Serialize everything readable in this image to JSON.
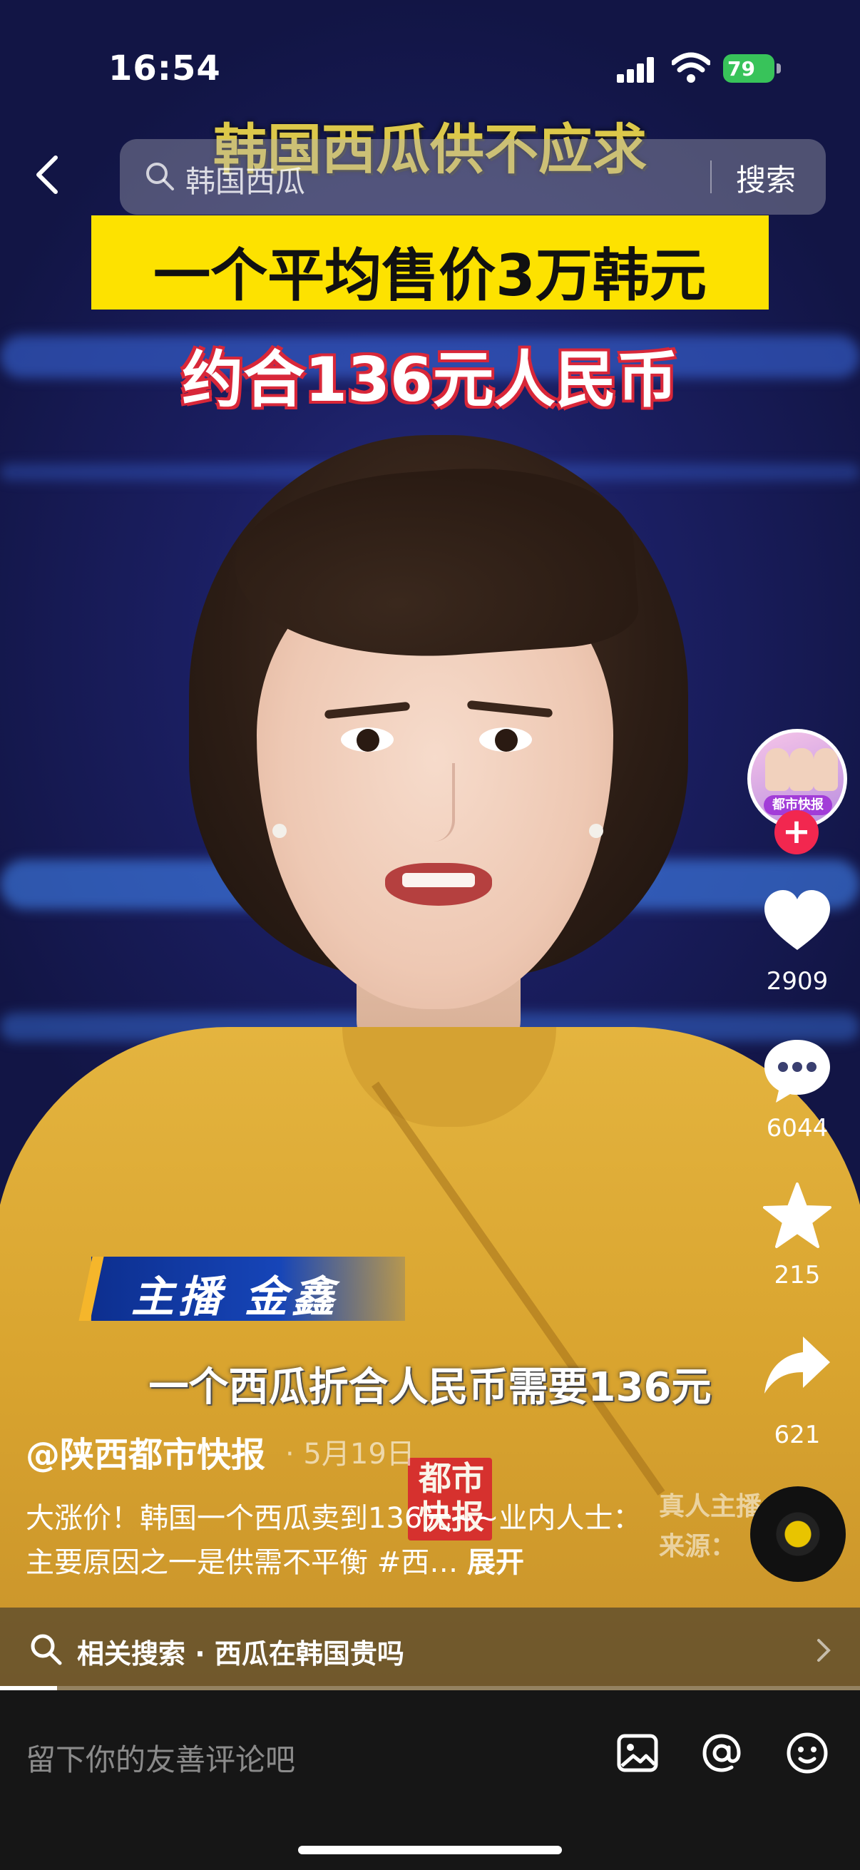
{
  "status_bar": {
    "time": "16:54",
    "battery": "79"
  },
  "search": {
    "query": "韩国西瓜",
    "button_label": "搜索"
  },
  "video": {
    "headline_1": "韩国西瓜供不应求",
    "headline_2": "一个平均售价3万韩元",
    "headline_3": "约合136元人民币",
    "anchor_label": "主播  金鑫",
    "subtitle": "一个西瓜折合人民币需要136元",
    "logo_text": "都市快报",
    "watermark_line1": "真人主播",
    "watermark_line2": "来源："
  },
  "actions": {
    "avatar_label": "都市快报",
    "follow_symbol": "+",
    "likes": "2909",
    "comments": "6044",
    "favorites": "215",
    "shares": "621"
  },
  "post": {
    "author": "@陕西都市快报",
    "date": "· 5月19日",
    "description": "大涨价！韩国一个西瓜卖到136元~~业内人士：主要原因之一是供需不平衡 #西…",
    "expand_label": "展开"
  },
  "related": {
    "text": "相关搜索 · 西瓜在韩国贵吗"
  },
  "comment_bar": {
    "placeholder": "留下你的友善评论吧"
  },
  "colors": {
    "accent_red": "#f2274f",
    "caption_yellow": "#fde200",
    "battery_green": "#38c35a"
  },
  "icons": [
    "back-icon",
    "search-icon",
    "heart-icon",
    "comment-icon",
    "star-icon",
    "share-icon",
    "image-icon",
    "at-icon",
    "emoji-icon",
    "chevron-right-icon"
  ]
}
